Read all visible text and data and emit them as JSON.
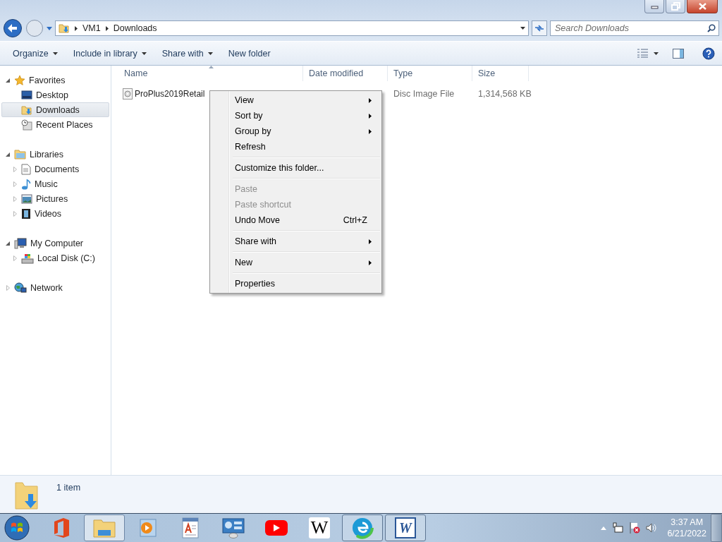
{
  "address": {
    "breadcrumbs": [
      "VM1",
      "Downloads"
    ]
  },
  "search": {
    "placeholder": "Search Downloads"
  },
  "toolbar": {
    "buttons": [
      {
        "label": "Organize",
        "dropdown": true
      },
      {
        "label": "Include in library",
        "dropdown": true
      },
      {
        "label": "Share with",
        "dropdown": true
      },
      {
        "label": "New folder",
        "dropdown": false
      }
    ]
  },
  "sidebar": {
    "groups": [
      {
        "label": "Favorites",
        "kind": "star",
        "expanded": true,
        "selected": false,
        "children": [
          {
            "label": "Desktop",
            "kind": "desktop",
            "selected": false
          },
          {
            "label": "Downloads",
            "kind": "downloads",
            "selected": true
          },
          {
            "label": "Recent Places",
            "kind": "recent",
            "selected": false
          }
        ]
      },
      {
        "label": "Libraries",
        "kind": "library",
        "expanded": true,
        "selected": false,
        "children": [
          {
            "label": "Documents",
            "kind": "document",
            "expanded": false,
            "selected": false
          },
          {
            "label": "Music",
            "kind": "music",
            "expanded": false,
            "selected": false
          },
          {
            "label": "Pictures",
            "kind": "pictures",
            "expanded": false,
            "selected": false
          },
          {
            "label": "Videos",
            "kind": "videos",
            "expanded": false,
            "selected": false
          }
        ]
      },
      {
        "label": "My Computer",
        "kind": "computer",
        "expanded": true,
        "selected": false,
        "children": [
          {
            "label": "Local Disk (C:)",
            "kind": "disk",
            "expanded": false,
            "selected": false
          }
        ]
      },
      {
        "label": "Network",
        "kind": "network",
        "expanded": false,
        "selected": false
      }
    ]
  },
  "table": {
    "columns": [
      {
        "label": "Name",
        "sorted": true
      },
      {
        "label": "Date modified",
        "sorted": false
      },
      {
        "label": "Type",
        "sorted": false
      },
      {
        "label": "Size",
        "sorted": false
      }
    ],
    "rows": [
      {
        "name": "ProPlus2019Retail",
        "type": "Disc Image File",
        "size": "1,314,568 KB"
      }
    ]
  },
  "context_menu": {
    "items": [
      {
        "kind": "item",
        "label": "View",
        "submenu": true,
        "disabled": false
      },
      {
        "kind": "item",
        "label": "Sort by",
        "submenu": true,
        "disabled": false
      },
      {
        "kind": "item",
        "label": "Group by",
        "submenu": true,
        "disabled": false
      },
      {
        "kind": "item",
        "label": "Refresh",
        "submenu": false,
        "disabled": false
      },
      {
        "kind": "separator"
      },
      {
        "kind": "item",
        "label": "Customize this folder...",
        "submenu": false,
        "disabled": false
      },
      {
        "kind": "separator"
      },
      {
        "kind": "item",
        "label": "Paste",
        "submenu": false,
        "disabled": true
      },
      {
        "kind": "item",
        "label": "Paste shortcut",
        "submenu": false,
        "disabled": true
      },
      {
        "kind": "item",
        "label": "Undo Move",
        "shortcut": "Ctrl+Z",
        "submenu": false,
        "disabled": false
      },
      {
        "kind": "separator"
      },
      {
        "kind": "item",
        "label": "Share with",
        "submenu": true,
        "disabled": false
      },
      {
        "kind": "separator"
      },
      {
        "kind": "item",
        "label": "New",
        "submenu": true,
        "disabled": false
      },
      {
        "kind": "separator"
      },
      {
        "kind": "item",
        "label": "Properties",
        "submenu": false,
        "disabled": false
      }
    ]
  },
  "status_bar": {
    "count": "1 item"
  },
  "taskbar": {
    "apps": [
      {
        "kind": "office",
        "running": false,
        "active": false
      },
      {
        "kind": "explorer",
        "running": true,
        "active": true
      },
      {
        "kind": "media",
        "running": false,
        "active": false
      },
      {
        "kind": "wordpad",
        "running": false,
        "active": false
      },
      {
        "kind": "control",
        "running": false,
        "active": false
      },
      {
        "kind": "youtube",
        "running": false,
        "active": false
      },
      {
        "kind": "wiki",
        "label": "W",
        "running": false,
        "active": false
      },
      {
        "kind": "edge",
        "running": true,
        "active": false
      },
      {
        "kind": "word",
        "label": "W",
        "running": true,
        "active": false
      }
    ],
    "clock": {
      "time": "3:37 AM",
      "date": "6/21/2022"
    }
  }
}
